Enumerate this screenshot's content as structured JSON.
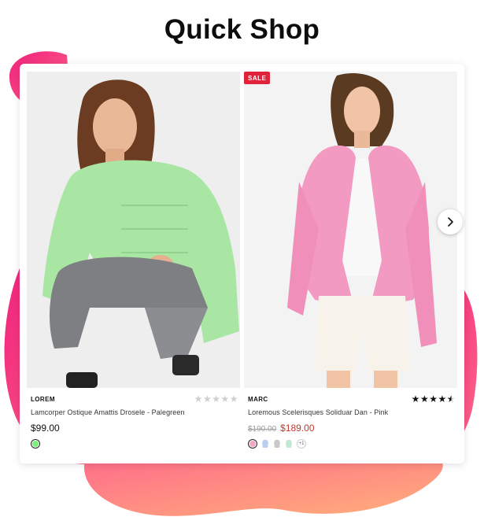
{
  "page": {
    "heading": "Quick Shop"
  },
  "theme": {
    "blob_pink": "#f0217d",
    "blob_orange": "#ff8d6b",
    "sale_red": "#e0233b",
    "price_red": "#c0392b"
  },
  "products": [
    {
      "brand": "LOREM",
      "title": "Lamcorper Ostique Amattis Drosele - Palegreen",
      "price": "$99.00",
      "rating": 0,
      "rating_max": 5,
      "image_subject": "woman in pale green knit sweater and grey jeans",
      "swatches": [
        {
          "name": "palegreen",
          "color": "#7cf07c",
          "selected": true
        }
      ]
    },
    {
      "badge": "SALE",
      "brand": "MARC",
      "title": "Loremous Scelerisques Soliduar Dan - Pink",
      "old_price": "$190.00",
      "price": "$189.00",
      "rating": 4.5,
      "rating_max": 5,
      "image_subject": "woman in pink blazer, white top and white shorts",
      "swatches": [
        {
          "name": "pink",
          "color": "#f2a8c6",
          "selected": true
        },
        {
          "name": "light-blue",
          "color": "#b9cfee",
          "selected": false
        },
        {
          "name": "grey",
          "color": "#c9c9c9",
          "selected": false
        },
        {
          "name": "mint",
          "color": "#bfe9d3",
          "selected": false
        }
      ],
      "more_colors": "+1"
    }
  ],
  "controls": {
    "next_icon": "chevron-right-icon"
  }
}
